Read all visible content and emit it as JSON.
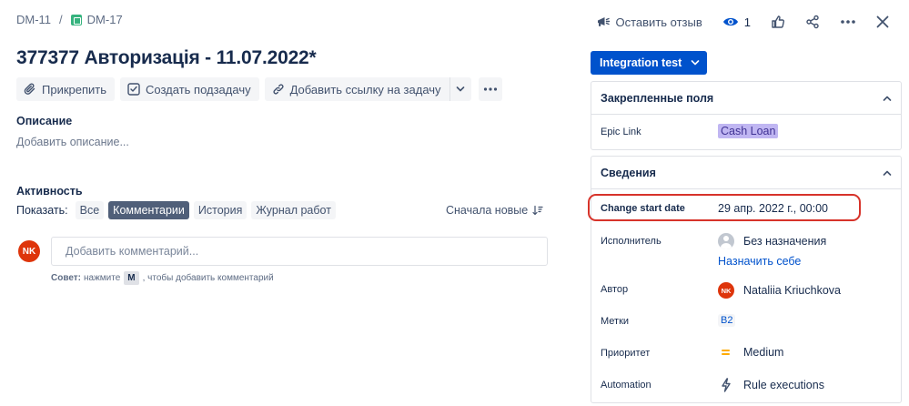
{
  "breadcrumb": {
    "parent": "DM-11",
    "separator": "/",
    "current": "DM-17"
  },
  "top_actions": {
    "feedback": "Оставить отзыв",
    "watchers_count": "1",
    "icons": [
      "megaphone-icon",
      "eye-icon",
      "thumbs-up-icon",
      "share-icon",
      "more-icon",
      "close-icon"
    ]
  },
  "issue": {
    "title": "377377 Авторизація - 11.07.2022*"
  },
  "toolbar": {
    "attach": "Прикрепить",
    "create_subtask": "Создать подзадачу",
    "add_link": "Добавить ссылку на задачу"
  },
  "description": {
    "label": "Описание",
    "placeholder": "Добавить описание..."
  },
  "activity": {
    "label": "Активность",
    "show_label": "Показать:",
    "filters": [
      "Все",
      "Комментарии",
      "История",
      "Журнал работ"
    ],
    "active_filter": "Комментарии",
    "sort": "Сначала новые"
  },
  "comment": {
    "avatar_initials": "NK",
    "placeholder": "Добавить комментарий...",
    "tip_prefix": "Совет:",
    "tip_press": "нажмите",
    "tip_key": "M",
    "tip_suffix": ", чтобы добавить комментарий"
  },
  "status": {
    "label": "Integration test"
  },
  "pinned": {
    "title": "Закрепленные поля",
    "epic_link_label": "Epic Link",
    "epic_link_value": "Cash Loan"
  },
  "details": {
    "title": "Сведения",
    "change_start_date_label": "Change start date",
    "change_start_date_value": "29 апр. 2022 г., 00:00",
    "assignee_label": "Исполнитель",
    "assignee_value": "Без назначения",
    "assign_to_me": "Назначить себе",
    "reporter_label": "Автор",
    "reporter_initials": "NK",
    "reporter_value": "Nataliia Kriuchkova",
    "labels_label": "Метки",
    "labels_value": "B2",
    "priority_label": "Приоритет",
    "priority_value": "Medium",
    "automation_label": "Automation",
    "automation_value": "Rule executions"
  },
  "colors": {
    "primary": "#0052cc",
    "text": "#172b4d",
    "epic_bg": "#c0b6f2",
    "avatar": "#de350b",
    "highlight": "#d7332a",
    "priority_medium": "#ffab00"
  }
}
